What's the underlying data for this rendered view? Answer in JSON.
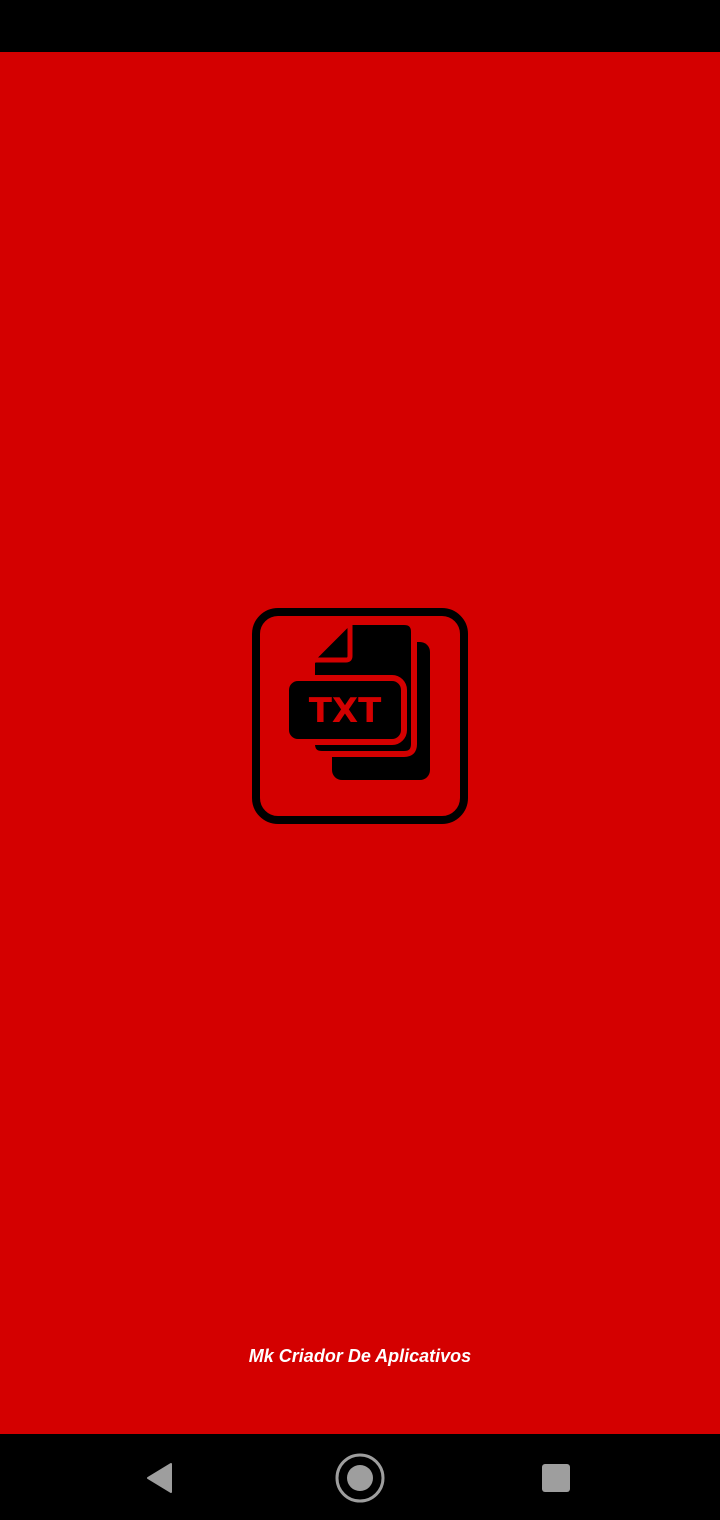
{
  "colors": {
    "splash_background": "#d40000",
    "system_bars": "#000000",
    "logo_foreground": "#000000",
    "credit_text": "#ffffff",
    "nav_icons": "#9e9e9e"
  },
  "splash": {
    "logo_icon": "txt-file-icon",
    "logo_text": "TXT",
    "credit": "Mk Criador De Aplicativos"
  },
  "navigation": {
    "back_icon": "back-triangle-icon",
    "home_icon": "home-circle-icon",
    "recents_icon": "recents-square-icon"
  }
}
